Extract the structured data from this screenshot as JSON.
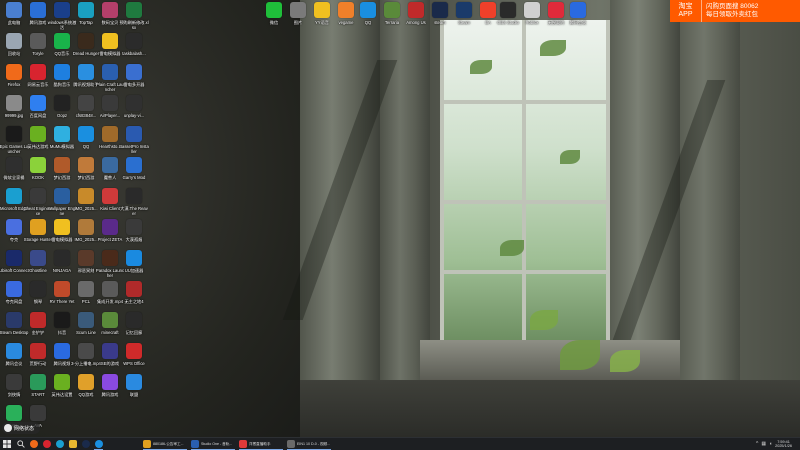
{
  "desktop": {
    "icons": [
      {
        "label": "此电脑",
        "color": "#4a7fd0"
      },
      {
        "label": "腾讯游戏",
        "color": "#2a6fd6"
      },
      {
        "label": "windows系统激活",
        "color": "#1a3f8a"
      },
      {
        "label": "TopTap",
        "color": "#1aa0c0"
      },
      {
        "label": "数码宝贝",
        "color": "#b43f6a"
      },
      {
        "label": "预购刷新修改.xlsx",
        "color": "#1f7a3f"
      },
      {
        "label": "回收站",
        "color": "#9aa6b2"
      },
      {
        "label": "Toryle",
        "color": "#5a5a5a"
      },
      {
        "label": "QQ音乐",
        "color": "#19b34a"
      },
      {
        "label": "Dread Hunger",
        "color": "#3a2a1c"
      },
      {
        "label": "雷电模拟器",
        "color": "#f0c020"
      },
      {
        "label": "taskbalash...",
        "color": "#2b2b2b"
      },
      {
        "label": "Firefox",
        "color": "#f06a1a"
      },
      {
        "label": "网易云音乐",
        "color": "#d8242f"
      },
      {
        "label": "酷狗音乐",
        "color": "#1e7fe0"
      },
      {
        "label": "腾讯视频助手",
        "color": "#2a8fe0"
      },
      {
        "label": "Plain Craft Launcher",
        "color": "#2a5fb0"
      },
      {
        "label": "雷电多开器",
        "color": "#3a6fd0"
      },
      {
        "label": "99999.jpg",
        "color": "#8a8a8a"
      },
      {
        "label": "百度网盘",
        "color": "#2f7ff0"
      },
      {
        "label": "Oopz",
        "color": "#222222"
      },
      {
        "label": "cfs83848...",
        "color": "#444444"
      },
      {
        "label": "AirPlayer...",
        "color": "#3a3a3a"
      },
      {
        "label": "unplay-vi...",
        "color": "#303030"
      },
      {
        "label": "Epic Games Launcher",
        "color": "#1a1a1a"
      },
      {
        "label": "英伟达游戏",
        "color": "#6ab020"
      },
      {
        "label": "MuMu模拟器",
        "color": "#2fb0e0"
      },
      {
        "label": "QQ",
        "color": "#1a8fe0"
      },
      {
        "label": "Hearthsto...",
        "color": "#a06a2a"
      },
      {
        "label": "BassetPro Installer",
        "color": "#2a5ab0"
      },
      {
        "label": "微软全家桶",
        "color": "#2f2f2f"
      },
      {
        "label": "KOOK",
        "color": "#8bd23a"
      },
      {
        "label": "梦幻西游",
        "color": "#b05a2a"
      },
      {
        "label": "梦幻西游",
        "color": "#c07a3a"
      },
      {
        "label": "魔兽人",
        "color": "#3a6aa0"
      },
      {
        "label": "Garry's Mod",
        "color": "#2a6fd0"
      },
      {
        "label": "Microsoft Edge",
        "color": "#1a9fd0"
      },
      {
        "label": "Cheat Engine.exe",
        "color": "#3a3a3a"
      },
      {
        "label": "Wallpaper Engine",
        "color": "#2a5fa0"
      },
      {
        "label": "IMG_2025...",
        "color": "#c88a2a"
      },
      {
        "label": "Kiwi Client",
        "color": "#d03a3a"
      },
      {
        "label": "大漠.The Reaver",
        "color": "#2a2a2a"
      },
      {
        "label": "夸克",
        "color": "#4a6fe0"
      },
      {
        "label": "Storage Hunter",
        "color": "#e0a020"
      },
      {
        "label": "雷电模拟器",
        "color": "#f0c020"
      },
      {
        "label": "IMG_2025...",
        "color": "#b07a3a"
      },
      {
        "label": "Project ZETA",
        "color": "#5a2a8a"
      },
      {
        "label": "大漠孤烟",
        "color": "#3a3a3a"
      },
      {
        "label": "Ubisoft Connect",
        "color": "#1a2a6a"
      },
      {
        "label": "Ghostline",
        "color": "#3a4a8a"
      },
      {
        "label": "NINJAGA",
        "color": "#2a2a2a"
      },
      {
        "label": "邪恶冥刻",
        "color": "#5a3a2a"
      },
      {
        "label": "Paradox Launcher",
        "color": "#4a2a1a"
      },
      {
        "label": "UU加速器",
        "color": "#1a8ae0"
      },
      {
        "label": "夸克网盘",
        "color": "#3a6ae0"
      },
      {
        "label": "钢琴",
        "color": "#2a2a2a"
      },
      {
        "label": "RV There Yet",
        "color": "#c04a2a"
      },
      {
        "label": "PCL",
        "color": "#6a6a6a"
      },
      {
        "label": "集成开发.mp4",
        "color": "#5a5a5a"
      },
      {
        "label": "无主之地4",
        "color": "#b02a2a"
      },
      {
        "label": "Steam Desktop",
        "color": "#2a3a6a"
      },
      {
        "label": "金铲铲",
        "color": "#c02a2a"
      },
      {
        "label": "抖音",
        "color": "#1a1a1a"
      },
      {
        "label": "Scum Line",
        "color": "#3a5a7a"
      },
      {
        "label": "minecraft",
        "color": "#5a8a3a"
      },
      {
        "label": "记忆回廊",
        "color": "#2a2a2a"
      },
      {
        "label": "腾讯会议",
        "color": "#2a8ae0"
      },
      {
        "label": "荒野行动",
        "color": "#c02a2a"
      },
      {
        "label": "腾讯视频",
        "color": "#2a6ae0"
      },
      {
        "label": "3-分上播电.mp4",
        "color": "#4a4a4a"
      },
      {
        "label": "SE的游戏",
        "color": "#3a3a8a"
      },
      {
        "label": "WPS Office",
        "color": "#d02a2a"
      },
      {
        "label": "剑侠情",
        "color": "#3a3a3a"
      },
      {
        "label": "START",
        "color": "#2a9a5a"
      },
      {
        "label": "英伟达设置",
        "color": "#6ab020"
      },
      {
        "label": "QQ游戏",
        "color": "#e0a02a"
      },
      {
        "label": "腾讯游戏",
        "color": "#8a4ae0"
      },
      {
        "label": "联盟",
        "color": "#2a8ae0"
      },
      {
        "label": "vga",
        "color": "#2ab05a"
      },
      {
        "label": "AVA",
        "color": "#3a3a3a"
      }
    ],
    "top_icons": [
      {
        "label": "微信",
        "color": "#1fbf3a"
      },
      {
        "label": "图片",
        "color": "#7a7a7a"
      },
      {
        "label": "YY语音",
        "color": "#f0c020"
      },
      {
        "label": "vegame",
        "color": "#f0802a"
      },
      {
        "label": "QQ",
        "color": "#1a8fe0"
      },
      {
        "label": "Terraria",
        "color": "#5a8a3a"
      },
      {
        "label": "Among Us",
        "color": "#c02a2a"
      },
      {
        "label": "steam",
        "color": "#1a2a4a"
      },
      {
        "label": "Steam",
        "color": "#1a3a6a"
      },
      {
        "label": "EA",
        "color": "#f0402a"
      },
      {
        "label": "OBS Studio",
        "color": "#2a2a2a"
      },
      {
        "label": "Roblox",
        "color": "#d0d0d0"
      },
      {
        "label": "无畏契约",
        "color": "#e02a3a"
      },
      {
        "label": "腾讯会议",
        "color": "#2a6ae0"
      }
    ]
  },
  "ad_banner": {
    "brand_line1": "淘宝",
    "brand_line2": "APP",
    "text_line1": "闪购页面搜 80062",
    "text_line2": "每日领取外卖红包"
  },
  "desktop_pill": {
    "text": "网络状态"
  },
  "taskbar": {
    "windows": [
      {
        "label": "880186-公告审工...",
        "color": "#e0a020"
      },
      {
        "label": "Studio One - 音轨...",
        "color": "#2a5fb0"
      },
      {
        "label": "洋葱直播助手",
        "color": "#e03a3a"
      },
      {
        "label": "EIN1 10 D-0 - 视频...",
        "color": "#6a6a6a"
      }
    ],
    "clock_time": "7:59:41",
    "clock_date": "2025/1/26"
  }
}
